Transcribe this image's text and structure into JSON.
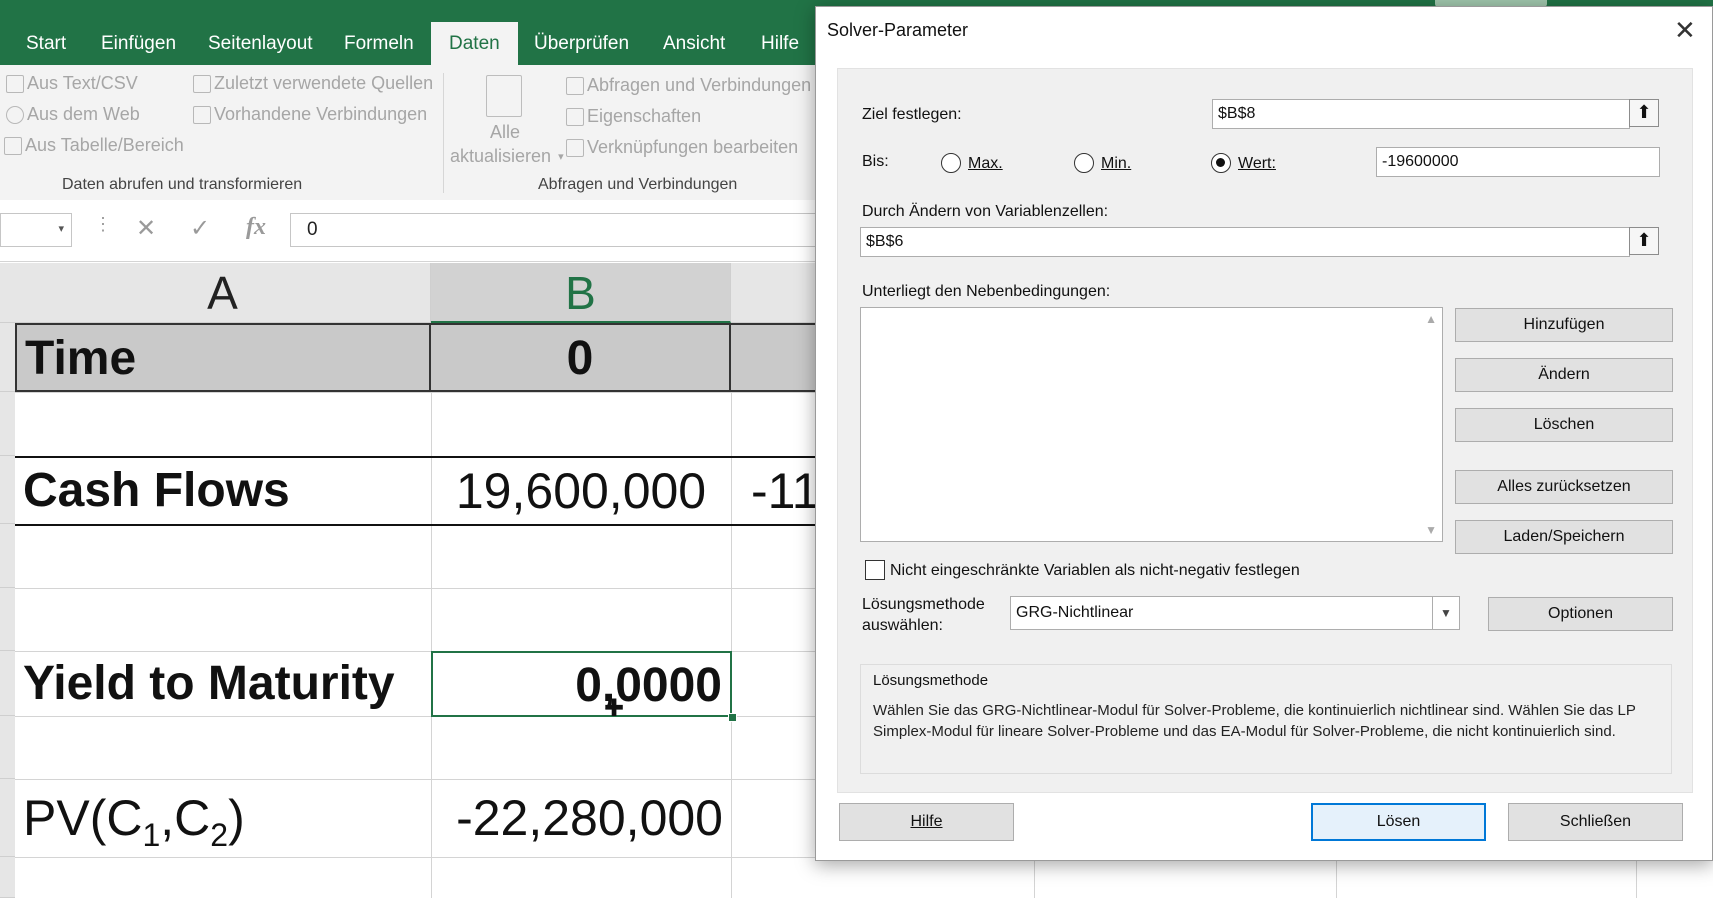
{
  "ribbon_tabs": [
    "Start",
    "Einfügen",
    "Seitenlayout",
    "Formeln",
    "Daten",
    "Überprüfen",
    "Ansicht",
    "Hilfe"
  ],
  "ribbon": {
    "group1": {
      "items": [
        "Aus Text/CSV",
        "Aus dem Web",
        "Aus Tabelle/Bereich",
        "Zuletzt verwendete Quellen",
        "Vorhandene Verbindungen"
      ],
      "label": "Daten abrufen und transformieren"
    },
    "group2": {
      "refresh_line1": "Alle",
      "refresh_line2": "aktualisieren",
      "items": [
        "Abfragen und Verbindungen",
        "Eigenschaften",
        "Verknüpfungen bearbeiten"
      ],
      "label": "Abfragen und Verbindungen"
    }
  },
  "formula_bar": {
    "value": "0",
    "fx": "fx"
  },
  "sheet": {
    "columns": [
      "A",
      "B"
    ],
    "cells": {
      "time_label": "Time",
      "time_value": "0",
      "cf_label": "Cash Flows",
      "cf_value": "19,600,000",
      "cf_next": "-11",
      "ytm_label": "Yield to Maturity",
      "ytm_value": "0,0000",
      "pv_label_main": "PV(C",
      "pv_sub1": "1",
      "pv_comma": ",C",
      "pv_sub2": "2",
      "pv_close": ")",
      "pv_value": "-22,280,000"
    }
  },
  "solver": {
    "title": "Solver-Parameter",
    "objective_label": "Ziel festlegen:",
    "objective_value": "$B$8",
    "to_label": "Bis:",
    "opt_max": "Max.",
    "opt_min": "Min.",
    "opt_value": "Wert:",
    "selected_option": "Wert",
    "target_value": "-19600000",
    "variables_label": "Durch Ändern von Variablenzellen:",
    "variables_value": "$B$6",
    "constraints_label": "Unterliegt den Nebenbedingungen:",
    "buttons": {
      "add": "Hinzufügen",
      "change": "Ändern",
      "delete": "Löschen",
      "reset_all": "Alles zurücksetzen",
      "load_save": "Laden/Speichern",
      "options": "Optionen",
      "help": "Hilfe",
      "solve": "Lösen",
      "close": "Schließen"
    },
    "nonneg_label": "Nicht eingeschränkte Variablen als nicht-negativ festlegen",
    "nonneg_checked": false,
    "method_label_1": "Lösungsmethode",
    "method_label_2": "auswählen:",
    "method_value": "GRG-Nichtlinear",
    "method_box_title": "Lösungsmethode",
    "method_box_text": "Wählen Sie das GRG-Nichtlinear-Modul für Solver-Probleme, die kontinuierlich nichtlinear sind. Wählen Sie das LP Simplex-Modul für lineare Solver-Probleme und das EA-Modul für Solver-Probleme, die nicht kontinuierlich sind."
  },
  "colors": {
    "excel_green": "#217346",
    "accent_blue": "#0078d7"
  }
}
